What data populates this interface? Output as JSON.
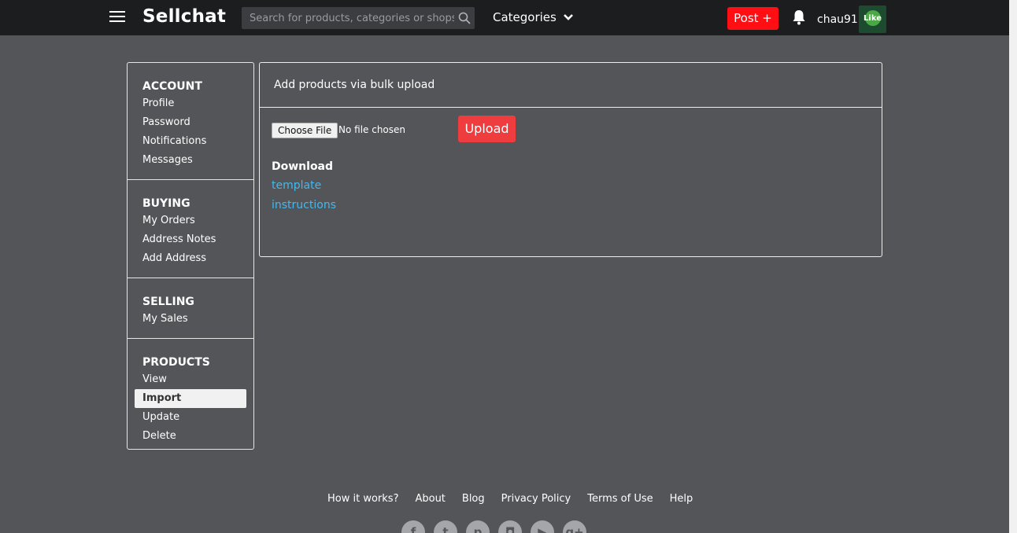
{
  "navbar": {
    "brand": "Sellchat",
    "search_placeholder": "Search for products, categories or shops ...",
    "categories_label": "Categories",
    "post_label": "Post +",
    "username": "chau91",
    "avatar_text": "Like"
  },
  "sidebar": {
    "sections": [
      {
        "title": "ACCOUNT",
        "items": [
          "Profile",
          "Password",
          "Notifications",
          "Messages"
        ]
      },
      {
        "title": "BUYING",
        "items": [
          "My Orders",
          "Address Notes",
          "Add Address"
        ]
      },
      {
        "title": "SELLING",
        "items": [
          "My Sales"
        ]
      },
      {
        "title": "PRODUCTS",
        "items": [
          "View",
          "Import",
          "Update",
          "Delete"
        ]
      }
    ],
    "active_item": "Import"
  },
  "panel": {
    "title": "Add products via bulk upload",
    "choose_file_label": "Choose File",
    "no_file_text": "No file chosen",
    "upload_label": "Upload",
    "download_title": "Download",
    "links": [
      "template",
      "instructions"
    ]
  },
  "footer": {
    "links": [
      "How it works?",
      "About",
      "Blog",
      "Privacy Policy",
      "Terms of Use",
      "Help"
    ],
    "socials": [
      "facebook-icon",
      "twitter-icon",
      "pinterest-icon",
      "instagram-icon",
      "youtube-icon",
      "google-plus-icon"
    ]
  },
  "colors": {
    "background": "#545559",
    "navbar": "#1c1d1f",
    "accent_red": "#ff0f13",
    "link_blue": "#43b8ee"
  }
}
